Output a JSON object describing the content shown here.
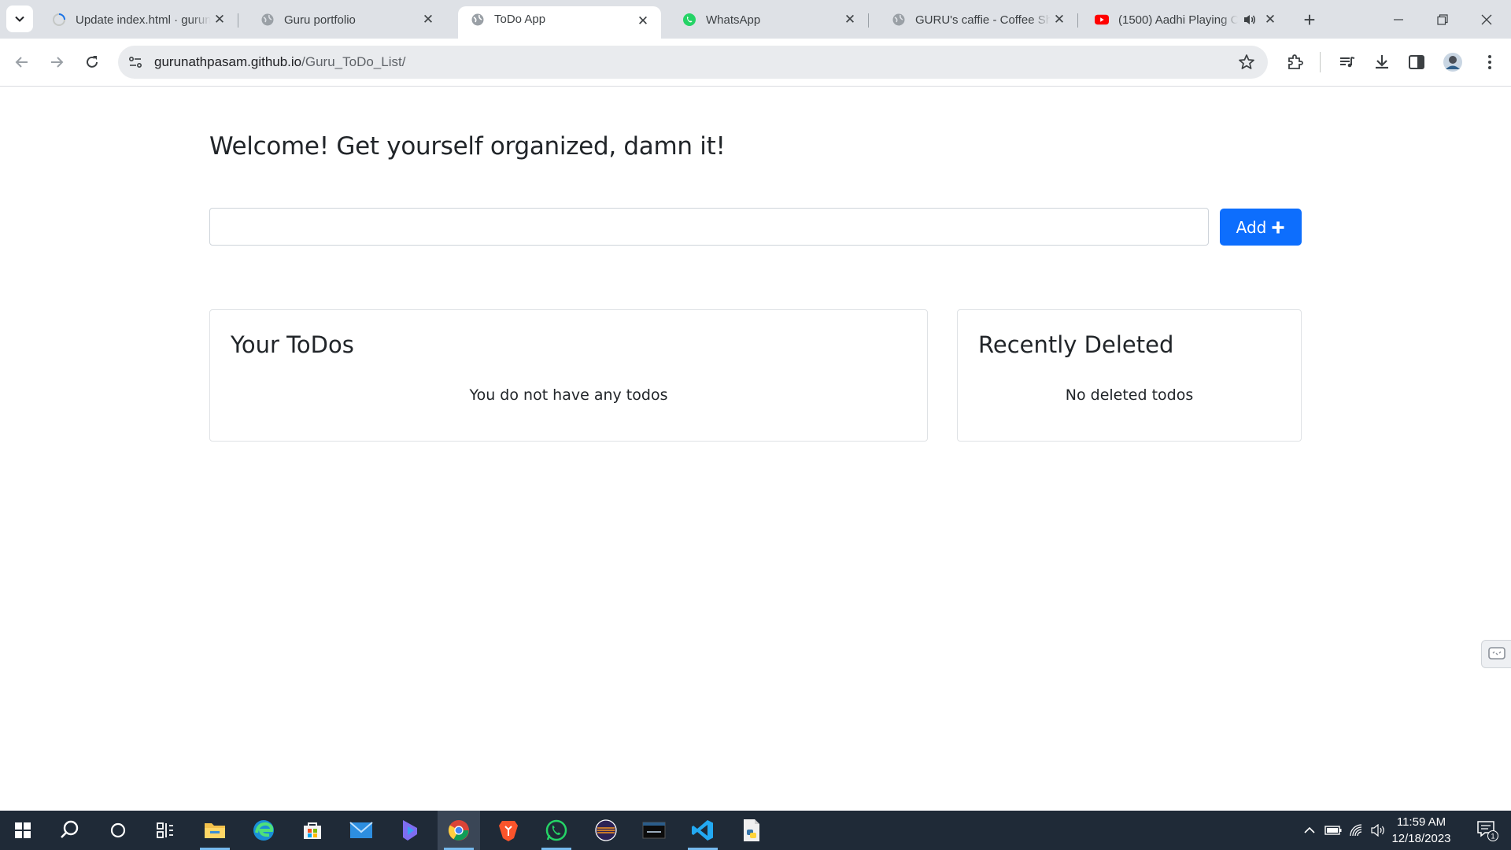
{
  "browser": {
    "tabs": [
      {
        "title": "Update index.html · gurunathpasam",
        "icon": "github-loading-icon",
        "active": false
      },
      {
        "title": "Guru portfolio",
        "icon": "globe-icon",
        "active": false
      },
      {
        "title": "ToDo App",
        "icon": "globe-icon",
        "active": true
      },
      {
        "title": "WhatsApp",
        "icon": "whatsapp-icon",
        "active": false
      },
      {
        "title": "GURU's caffie - Coffee Shop",
        "icon": "globe-icon",
        "active": false
      },
      {
        "title": "(1500) Aadhi Playing C",
        "icon": "youtube-icon",
        "active": false
      }
    ],
    "url_host": "gurunathpasam.github.io",
    "url_path": "/Guru_ToDo_List/"
  },
  "page": {
    "title": "Welcome! Get yourself organized, damn it!",
    "input_value": "",
    "add_button_label": "Add",
    "todos_card": {
      "title": "Your ToDos",
      "empty_message": "You do not have any todos"
    },
    "deleted_card": {
      "title": "Recently Deleted",
      "empty_message": "No deleted todos"
    }
  },
  "taskbar": {
    "time": "11:59 AM",
    "date": "12/18/2023",
    "notification_count": "1"
  },
  "colors": {
    "accent": "#0d6efd",
    "tabstrip": "#dee1e6",
    "taskbar": "#1f2a37"
  }
}
